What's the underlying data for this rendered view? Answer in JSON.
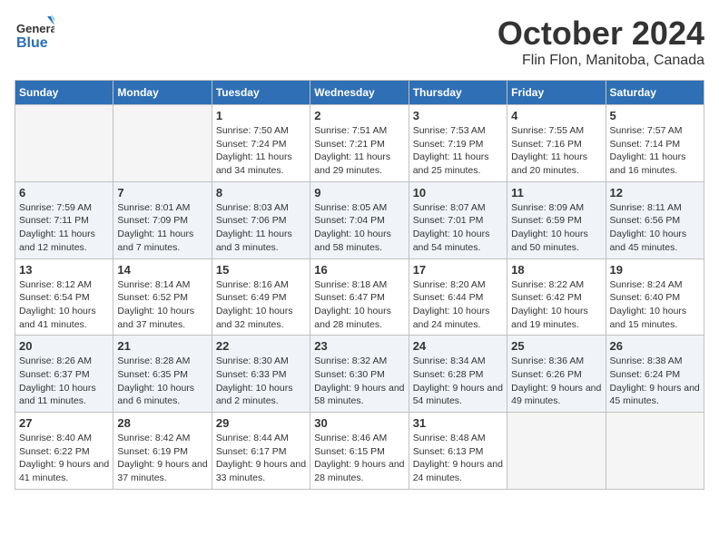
{
  "header": {
    "logo_line1": "General",
    "logo_line2": "Blue",
    "month_title": "October 2024",
    "location": "Flin Flon, Manitoba, Canada"
  },
  "days_of_week": [
    "Sunday",
    "Monday",
    "Tuesday",
    "Wednesday",
    "Thursday",
    "Friday",
    "Saturday"
  ],
  "weeks": [
    [
      {
        "day": "",
        "sunrise": "",
        "sunset": "",
        "daylight": "",
        "empty": true
      },
      {
        "day": "",
        "sunrise": "",
        "sunset": "",
        "daylight": "",
        "empty": true
      },
      {
        "day": "1",
        "sunrise": "Sunrise: 7:50 AM",
        "sunset": "Sunset: 7:24 PM",
        "daylight": "Daylight: 11 hours and 34 minutes."
      },
      {
        "day": "2",
        "sunrise": "Sunrise: 7:51 AM",
        "sunset": "Sunset: 7:21 PM",
        "daylight": "Daylight: 11 hours and 29 minutes."
      },
      {
        "day": "3",
        "sunrise": "Sunrise: 7:53 AM",
        "sunset": "Sunset: 7:19 PM",
        "daylight": "Daylight: 11 hours and 25 minutes."
      },
      {
        "day": "4",
        "sunrise": "Sunrise: 7:55 AM",
        "sunset": "Sunset: 7:16 PM",
        "daylight": "Daylight: 11 hours and 20 minutes."
      },
      {
        "day": "5",
        "sunrise": "Sunrise: 7:57 AM",
        "sunset": "Sunset: 7:14 PM",
        "daylight": "Daylight: 11 hours and 16 minutes."
      }
    ],
    [
      {
        "day": "6",
        "sunrise": "Sunrise: 7:59 AM",
        "sunset": "Sunset: 7:11 PM",
        "daylight": "Daylight: 11 hours and 12 minutes."
      },
      {
        "day": "7",
        "sunrise": "Sunrise: 8:01 AM",
        "sunset": "Sunset: 7:09 PM",
        "daylight": "Daylight: 11 hours and 7 minutes."
      },
      {
        "day": "8",
        "sunrise": "Sunrise: 8:03 AM",
        "sunset": "Sunset: 7:06 PM",
        "daylight": "Daylight: 11 hours and 3 minutes."
      },
      {
        "day": "9",
        "sunrise": "Sunrise: 8:05 AM",
        "sunset": "Sunset: 7:04 PM",
        "daylight": "Daylight: 10 hours and 58 minutes."
      },
      {
        "day": "10",
        "sunrise": "Sunrise: 8:07 AM",
        "sunset": "Sunset: 7:01 PM",
        "daylight": "Daylight: 10 hours and 54 minutes."
      },
      {
        "day": "11",
        "sunrise": "Sunrise: 8:09 AM",
        "sunset": "Sunset: 6:59 PM",
        "daylight": "Daylight: 10 hours and 50 minutes."
      },
      {
        "day": "12",
        "sunrise": "Sunrise: 8:11 AM",
        "sunset": "Sunset: 6:56 PM",
        "daylight": "Daylight: 10 hours and 45 minutes."
      }
    ],
    [
      {
        "day": "13",
        "sunrise": "Sunrise: 8:12 AM",
        "sunset": "Sunset: 6:54 PM",
        "daylight": "Daylight: 10 hours and 41 minutes."
      },
      {
        "day": "14",
        "sunrise": "Sunrise: 8:14 AM",
        "sunset": "Sunset: 6:52 PM",
        "daylight": "Daylight: 10 hours and 37 minutes."
      },
      {
        "day": "15",
        "sunrise": "Sunrise: 8:16 AM",
        "sunset": "Sunset: 6:49 PM",
        "daylight": "Daylight: 10 hours and 32 minutes."
      },
      {
        "day": "16",
        "sunrise": "Sunrise: 8:18 AM",
        "sunset": "Sunset: 6:47 PM",
        "daylight": "Daylight: 10 hours and 28 minutes."
      },
      {
        "day": "17",
        "sunrise": "Sunrise: 8:20 AM",
        "sunset": "Sunset: 6:44 PM",
        "daylight": "Daylight: 10 hours and 24 minutes."
      },
      {
        "day": "18",
        "sunrise": "Sunrise: 8:22 AM",
        "sunset": "Sunset: 6:42 PM",
        "daylight": "Daylight: 10 hours and 19 minutes."
      },
      {
        "day": "19",
        "sunrise": "Sunrise: 8:24 AM",
        "sunset": "Sunset: 6:40 PM",
        "daylight": "Daylight: 10 hours and 15 minutes."
      }
    ],
    [
      {
        "day": "20",
        "sunrise": "Sunrise: 8:26 AM",
        "sunset": "Sunset: 6:37 PM",
        "daylight": "Daylight: 10 hours and 11 minutes."
      },
      {
        "day": "21",
        "sunrise": "Sunrise: 8:28 AM",
        "sunset": "Sunset: 6:35 PM",
        "daylight": "Daylight: 10 hours and 6 minutes."
      },
      {
        "day": "22",
        "sunrise": "Sunrise: 8:30 AM",
        "sunset": "Sunset: 6:33 PM",
        "daylight": "Daylight: 10 hours and 2 minutes."
      },
      {
        "day": "23",
        "sunrise": "Sunrise: 8:32 AM",
        "sunset": "Sunset: 6:30 PM",
        "daylight": "Daylight: 9 hours and 58 minutes."
      },
      {
        "day": "24",
        "sunrise": "Sunrise: 8:34 AM",
        "sunset": "Sunset: 6:28 PM",
        "daylight": "Daylight: 9 hours and 54 minutes."
      },
      {
        "day": "25",
        "sunrise": "Sunrise: 8:36 AM",
        "sunset": "Sunset: 6:26 PM",
        "daylight": "Daylight: 9 hours and 49 minutes."
      },
      {
        "day": "26",
        "sunrise": "Sunrise: 8:38 AM",
        "sunset": "Sunset: 6:24 PM",
        "daylight": "Daylight: 9 hours and 45 minutes."
      }
    ],
    [
      {
        "day": "27",
        "sunrise": "Sunrise: 8:40 AM",
        "sunset": "Sunset: 6:22 PM",
        "daylight": "Daylight: 9 hours and 41 minutes."
      },
      {
        "day": "28",
        "sunrise": "Sunrise: 8:42 AM",
        "sunset": "Sunset: 6:19 PM",
        "daylight": "Daylight: 9 hours and 37 minutes."
      },
      {
        "day": "29",
        "sunrise": "Sunrise: 8:44 AM",
        "sunset": "Sunset: 6:17 PM",
        "daylight": "Daylight: 9 hours and 33 minutes."
      },
      {
        "day": "30",
        "sunrise": "Sunrise: 8:46 AM",
        "sunset": "Sunset: 6:15 PM",
        "daylight": "Daylight: 9 hours and 28 minutes."
      },
      {
        "day": "31",
        "sunrise": "Sunrise: 8:48 AM",
        "sunset": "Sunset: 6:13 PM",
        "daylight": "Daylight: 9 hours and 24 minutes."
      },
      {
        "day": "",
        "sunrise": "",
        "sunset": "",
        "daylight": "",
        "empty": true
      },
      {
        "day": "",
        "sunrise": "",
        "sunset": "",
        "daylight": "",
        "empty": true
      }
    ]
  ]
}
